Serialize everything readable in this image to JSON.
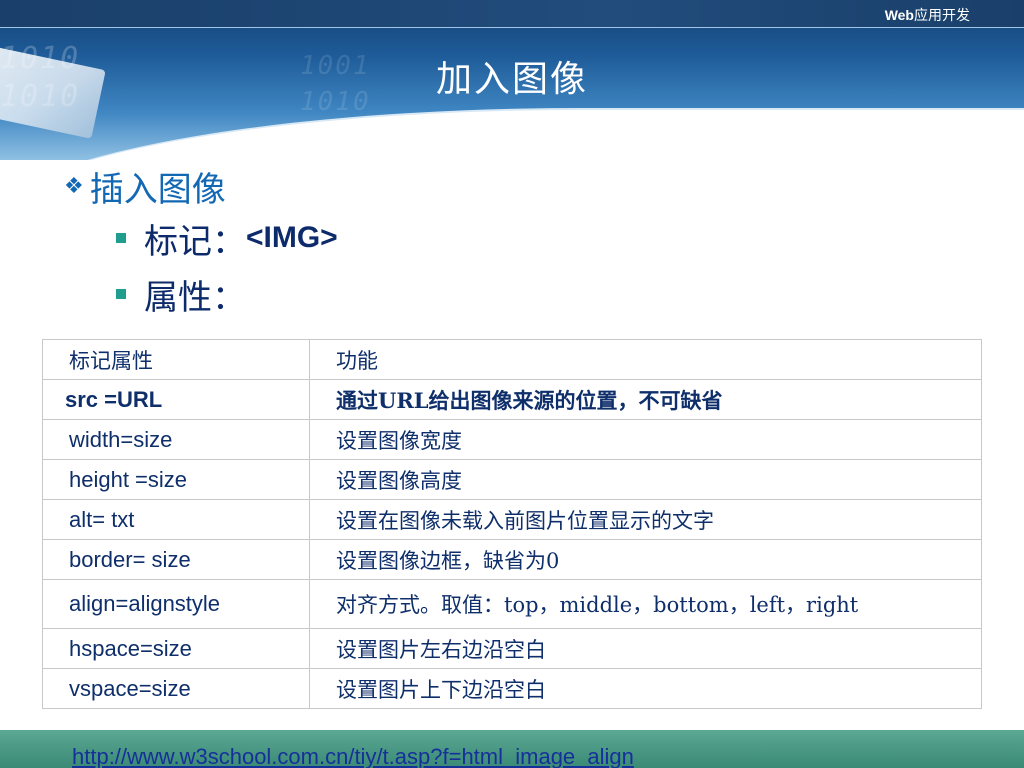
{
  "header": {
    "brand_bold": "Web",
    "brand_rest": "应用开发",
    "title": "加入图像",
    "binary_left": "1010\n1010",
    "binary_right": "1001\n1010"
  },
  "bullets": {
    "heading": "插入图像",
    "item1_label": "标记：",
    "item1_code": "<IMG>",
    "item2_label": "属性："
  },
  "table": {
    "header": [
      "标记属性",
      "功能"
    ],
    "rows": [
      [
        "src =URL",
        "通过URL给出图像来源的位置，不可缺省"
      ],
      [
        "width=size",
        "设置图像宽度"
      ],
      [
        "height =size",
        "设置图像高度"
      ],
      [
        "alt= txt",
        "设置在图像未载入前图片位置显示的文字"
      ],
      [
        "border= size",
        "设置图像边框，缺省为0"
      ],
      [
        "align=alignstyle",
        "对齐方式。取值：top，middle，bottom，left，right"
      ],
      [
        "hspace=size",
        "设置图片左右边沿空白"
      ],
      [
        "vspace=size",
        "设置图片上下边沿空白"
      ]
    ]
  },
  "footer": {
    "link": "http://www.w3school.com.cn/tiy/t.asp?f=html_image_align"
  }
}
